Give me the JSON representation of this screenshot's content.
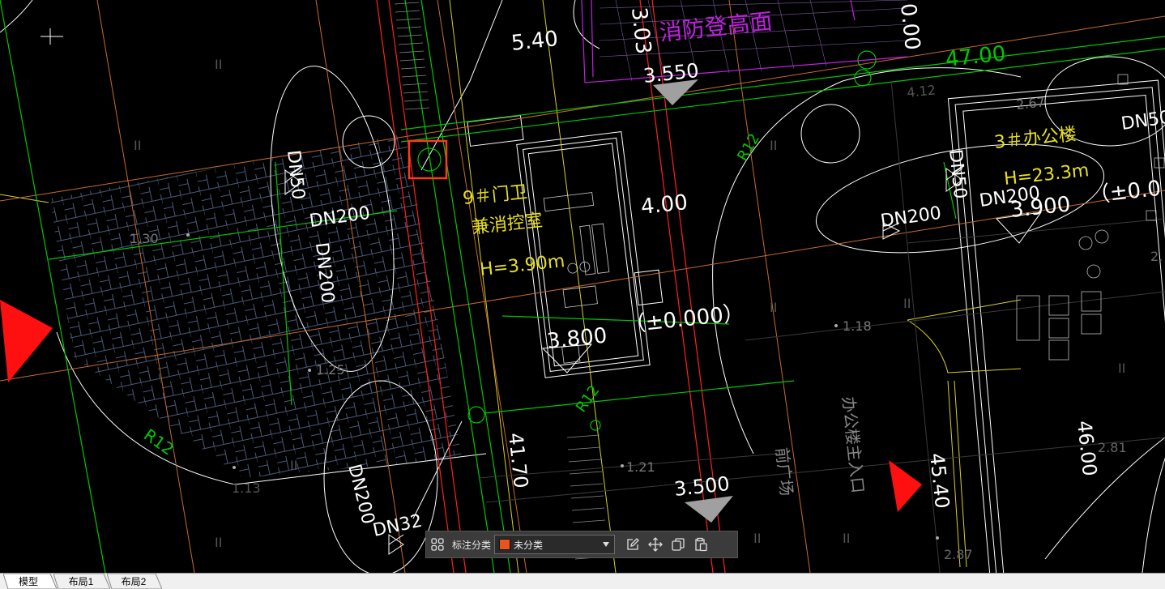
{
  "drawing": {
    "labels": {
      "dim_540": "5.40",
      "dim_303": "3.03",
      "dim_000": "0.00",
      "fire_face": "消防登高面",
      "elev_3550": "3.550",
      "dim_4700": "47.00",
      "dim_267": "2.67",
      "dim_412": "4.12",
      "r12_top": "R12",
      "building_3_name": "3＃办公楼",
      "building_3_height": "H=23.3m",
      "building_3_elev": "3.900",
      "building_3_zero": "（±0.0",
      "dn50_left": "DN50",
      "dn200_left": "DN200",
      "dn200_left_vert": "DN200",
      "dn50_right": "DN50",
      "dn200_right_a": "DN200",
      "dn200_right_b": "DN200",
      "guard_name": "9＃门卫",
      "guard_sub": "兼消控室",
      "guard_height": "H=3.90m",
      "dim_400": "4.00",
      "elev_3800": "3.800",
      "zero_000": "（±0.000）",
      "spot_130": "1.30",
      "spot_125": "1.25",
      "spot_118": "1.18",
      "spot_121": "1.21",
      "spot_113": "1.13",
      "spot_281": "2.81",
      "spot_287": "2.87",
      "spot_2": "2.",
      "r12_left": "R12",
      "r12_mid": "R12",
      "dim_4170": "41.70",
      "dn200_bottom": "DN200",
      "dn32_bottom": "DN32",
      "elev_3500": "3.500",
      "plaza": "前广场",
      "main_entrance": "办公楼主入口",
      "dim_4540": "45.40",
      "dim_4600": "46.00",
      "ii": "II",
      "dn50_far": "DN50"
    },
    "colors": {
      "white_line": "#ffffff",
      "green_line": "#00c800",
      "orange_line": "#c86a2a",
      "red_line": "#ff2020",
      "magenta_line": "#c020e0",
      "yellow_text": "#e8e020",
      "grey_text": "#8a8a8a",
      "marker_red": "#ff1010",
      "highlight_box": "#ff3a1a"
    }
  },
  "toolbar": {
    "label": "标注分类",
    "category_value": "未分类",
    "category_color": "#e8541e",
    "icons": {
      "grid": "grid-icon",
      "edit": "edit-icon",
      "move": "move-icon",
      "copy": "copy-icon",
      "paste": "paste-icon"
    }
  },
  "tabs": [
    {
      "label": "模型"
    },
    {
      "label": "布局1"
    },
    {
      "label": "布局2"
    }
  ]
}
